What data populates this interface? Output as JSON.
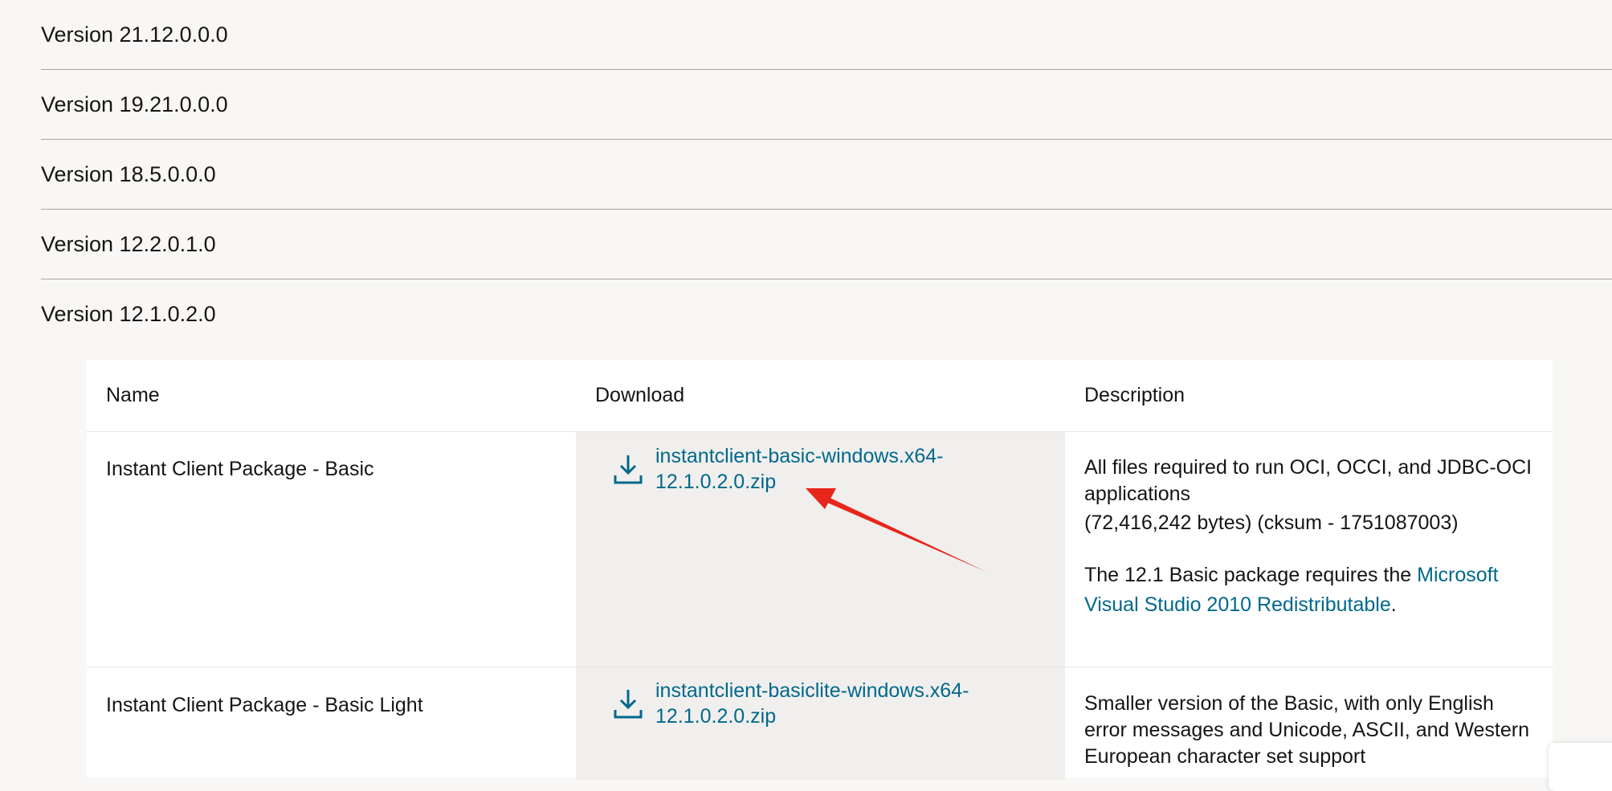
{
  "versions": [
    {
      "label": "Version 21.12.0.0.0"
    },
    {
      "label": "Version 19.21.0.0.0"
    },
    {
      "label": "Version 18.5.0.0.0"
    },
    {
      "label": "Version 12.2.0.1.0"
    },
    {
      "label": "Version 12.1.0.2.0"
    }
  ],
  "table": {
    "headers": {
      "name": "Name",
      "download": "Download",
      "description": "Description"
    },
    "rows": [
      {
        "name": "Instant Client Package - Basic",
        "download_line1": "instantclient-basic-windows.x64-",
        "download_line2": "12.1.0.2.0.zip",
        "desc_line1": "All files required to run OCI, OCCI, and JDBC-OCI",
        "desc_line2": "applications",
        "desc_line3": "(72,416,242 bytes) (cksum - 1751087003)",
        "desc_note_prefix": "The 12.1 Basic package requires the ",
        "desc_note_link1": "Microsoft",
        "desc_note_link2": "Visual Studio 2010 Redistributable",
        "desc_note_suffix": "."
      },
      {
        "name": "Instant Client Package - Basic Light",
        "download_line1": "instantclient-basiclite-windows.x64-",
        "download_line2": "12.1.0.2.0.zip",
        "desc_line1": "Smaller version of the Basic, with only English",
        "desc_line2": "error messages and Unicode, ASCII, and Western",
        "desc_line3": "European character set support"
      }
    ]
  },
  "colors": {
    "link": "#00688c",
    "annotation_arrow": "#e8261c",
    "page_bg": "#f8f7f5",
    "download_col_bg": "#f0efed"
  },
  "icons": {
    "download": "download-icon",
    "annotation": "red-arrow-annotation"
  }
}
